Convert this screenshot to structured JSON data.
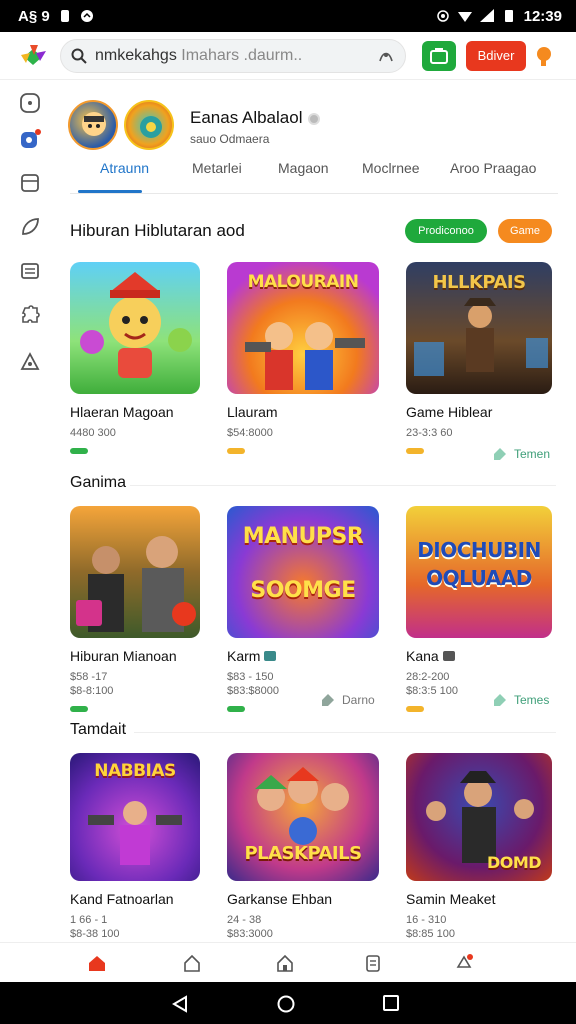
{
  "status": {
    "left_text": "A§ 9",
    "time": "12:39"
  },
  "topbar": {
    "search_text_main": "nmkekahgs",
    "search_text_dim": "Imahars .daurm..",
    "red_button_label": "Bdiver"
  },
  "profile": {
    "name": "Eanas Albalaol",
    "subtitle": "sauo Odmaera"
  },
  "tabs": [
    {
      "label": "Atraunn"
    },
    {
      "label": "Metarlei"
    },
    {
      "label": "Magaon"
    },
    {
      "label": "Moclrnee"
    },
    {
      "label": "Aroo Praagao"
    }
  ],
  "sections": [
    {
      "title": "Hiburan Hiblutaran aod",
      "pill_green": "Prodiconoo",
      "pill_orange": "Game",
      "cards": [
        {
          "title": "Hlaeran Magoan",
          "meta1": "4480 300",
          "meta2": "",
          "art_text": "",
          "star_color": "#30b14a"
        },
        {
          "title": "Llauram",
          "meta1": "$54:8000",
          "meta2": "",
          "art_text": "MALOURAIN",
          "star_color": "#f3b42b"
        },
        {
          "title": "Game Hiblear",
          "meta1": "23-3:3 60",
          "meta2": "",
          "art_text": "HLLKPAIS",
          "star_color": "#f3b42b"
        }
      ],
      "tag_text": "Temen"
    },
    {
      "title": "Ganima",
      "cards": [
        {
          "title": "Hiburan Mianoan",
          "meta1": "$58 -17",
          "meta2": "$8-8:100",
          "art_text": "",
          "star_color": "#30b14a"
        },
        {
          "title": "Karm",
          "meta1": "$83 - 150",
          "meta2": "$83:$8000",
          "art_text": "MANUPSR SOOMGE",
          "star_color": "#30b14a"
        },
        {
          "title": "Kana",
          "meta1": "28:2-200",
          "meta2": "$8:3:5 100",
          "art_text": "DIOCHUBIN OQLUAAD",
          "star_color": "#f3b42b"
        }
      ],
      "tag_text_1": "Darno",
      "tag_text_2": "Temes"
    },
    {
      "title": "Tamdait",
      "cards": [
        {
          "title": "Kand Fatnoarlan",
          "meta1": "1 66 - 1",
          "meta2": "$8-38 100",
          "art_text": "NABBIAS",
          "star_color": "#30b14a"
        },
        {
          "title": "Garkanse Ehban",
          "meta1": "24 - 38",
          "meta2": "$83:3000",
          "art_text": "PLASKPAILS",
          "star_color": "#30b14a"
        },
        {
          "title": "Samin Meaket",
          "meta1": "16 - 310",
          "meta2": "$8:85 100",
          "art_text": "DOMD",
          "star_color": "#f3b42b"
        }
      ]
    }
  ],
  "colors": {
    "accent": "#2075c9",
    "green": "#1fa93c",
    "red": "#e8381e",
    "orange": "#f58a1f"
  }
}
